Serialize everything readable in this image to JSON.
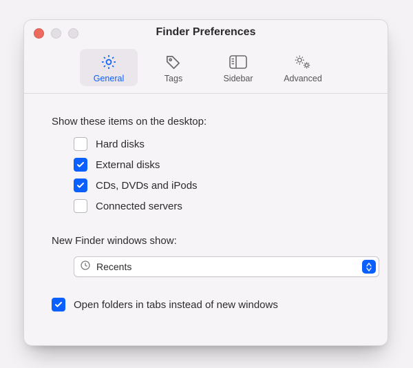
{
  "title": "Finder Preferences",
  "tabs": [
    {
      "id": "general",
      "label": "General",
      "active": true
    },
    {
      "id": "tags",
      "label": "Tags",
      "active": false
    },
    {
      "id": "sidebar",
      "label": "Sidebar",
      "active": false
    },
    {
      "id": "advanced",
      "label": "Advanced",
      "active": false
    }
  ],
  "desktop": {
    "heading": "Show these items on the desktop:",
    "items": [
      {
        "id": "hard-disks",
        "label": "Hard disks",
        "checked": false
      },
      {
        "id": "external-disks",
        "label": "External disks",
        "checked": true
      },
      {
        "id": "cds-dvds-ipods",
        "label": "CDs, DVDs and iPods",
        "checked": true
      },
      {
        "id": "connected-servers",
        "label": "Connected servers",
        "checked": false
      }
    ]
  },
  "newWindow": {
    "heading": "New Finder windows show:",
    "selected": "Recents",
    "icon": "clock-icon"
  },
  "openInTabs": {
    "label": "Open folders in tabs instead of new windows",
    "checked": true
  },
  "colors": {
    "accent": "#0a60ff"
  }
}
